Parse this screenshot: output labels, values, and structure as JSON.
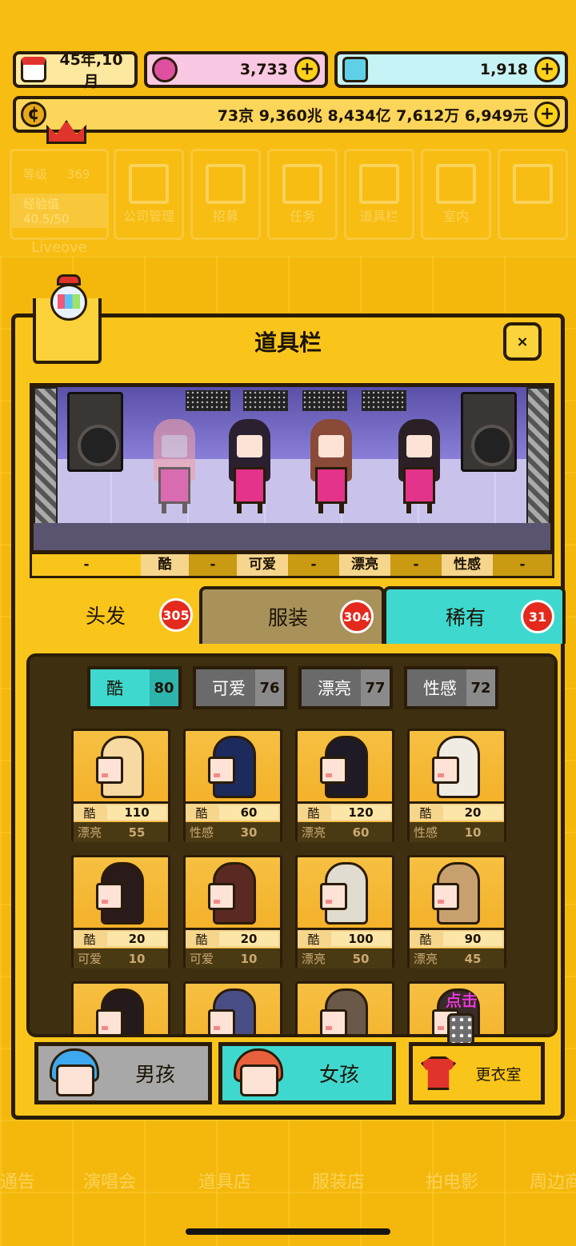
{
  "top": {
    "date": "45年,10月",
    "gems": "3,733",
    "diamonds": "1,918",
    "money": "73京 9,360兆 8,434亿 7,612万 6,949元"
  },
  "level": {
    "label": "等级",
    "value": "369",
    "exp_label": "经验值",
    "exp_value": "40.5/50",
    "company": "Liveove"
  },
  "menu": [
    "公司管理",
    "招募",
    "任务",
    "道具栏",
    "室内"
  ],
  "panel": {
    "title": "道具栏",
    "close": "×"
  },
  "stage_tabs": [
    "-",
    "酷",
    "-",
    "可爱",
    "-",
    "漂亮",
    "-",
    "性感",
    "-"
  ],
  "tabs": [
    {
      "label": "头发",
      "count": "305"
    },
    {
      "label": "服装",
      "count": "304"
    },
    {
      "label": "稀有",
      "count": "31"
    }
  ],
  "filters": [
    {
      "label": "酷",
      "count": "80"
    },
    {
      "label": "可爱",
      "count": "76"
    },
    {
      "label": "漂亮",
      "count": "77"
    },
    {
      "label": "性感",
      "count": "72"
    }
  ],
  "items": [
    {
      "s1": "酷",
      "v1": "110",
      "s2": "漂亮",
      "v2": "55",
      "hair": "#f7d9a2"
    },
    {
      "s1": "酷",
      "v1": "60",
      "s2": "性感",
      "v2": "30",
      "hair": "#1c2a5c"
    },
    {
      "s1": "酷",
      "v1": "120",
      "s2": "漂亮",
      "v2": "60",
      "hair": "#1e1a26"
    },
    {
      "s1": "酷",
      "v1": "20",
      "s2": "性感",
      "v2": "10",
      "hair": "#f0ece4"
    },
    {
      "s1": "酷",
      "v1": "20",
      "s2": "可爱",
      "v2": "10",
      "hair": "#2a1a1a"
    },
    {
      "s1": "酷",
      "v1": "20",
      "s2": "可爱",
      "v2": "10",
      "hair": "#5a2a22"
    },
    {
      "s1": "酷",
      "v1": "100",
      "s2": "漂亮",
      "v2": "50",
      "hair": "#e0dccf"
    },
    {
      "s1": "酷",
      "v1": "90",
      "s2": "漂亮",
      "v2": "45",
      "hair": "#c8a070"
    }
  ],
  "partial_items": [
    {
      "hair": "#241a1c"
    },
    {
      "hair": "#4a4e86"
    },
    {
      "hair": "#6a5848"
    },
    {
      "hair": "#3a2a2a"
    }
  ],
  "bottom": {
    "boy": "男孩",
    "girl": "女孩",
    "wardrobe": "更衣室",
    "tip": "点击"
  },
  "bottom_menu": [
    "通告",
    "演唱会",
    "道具店",
    "服装店",
    "拍电影",
    "周边商"
  ]
}
